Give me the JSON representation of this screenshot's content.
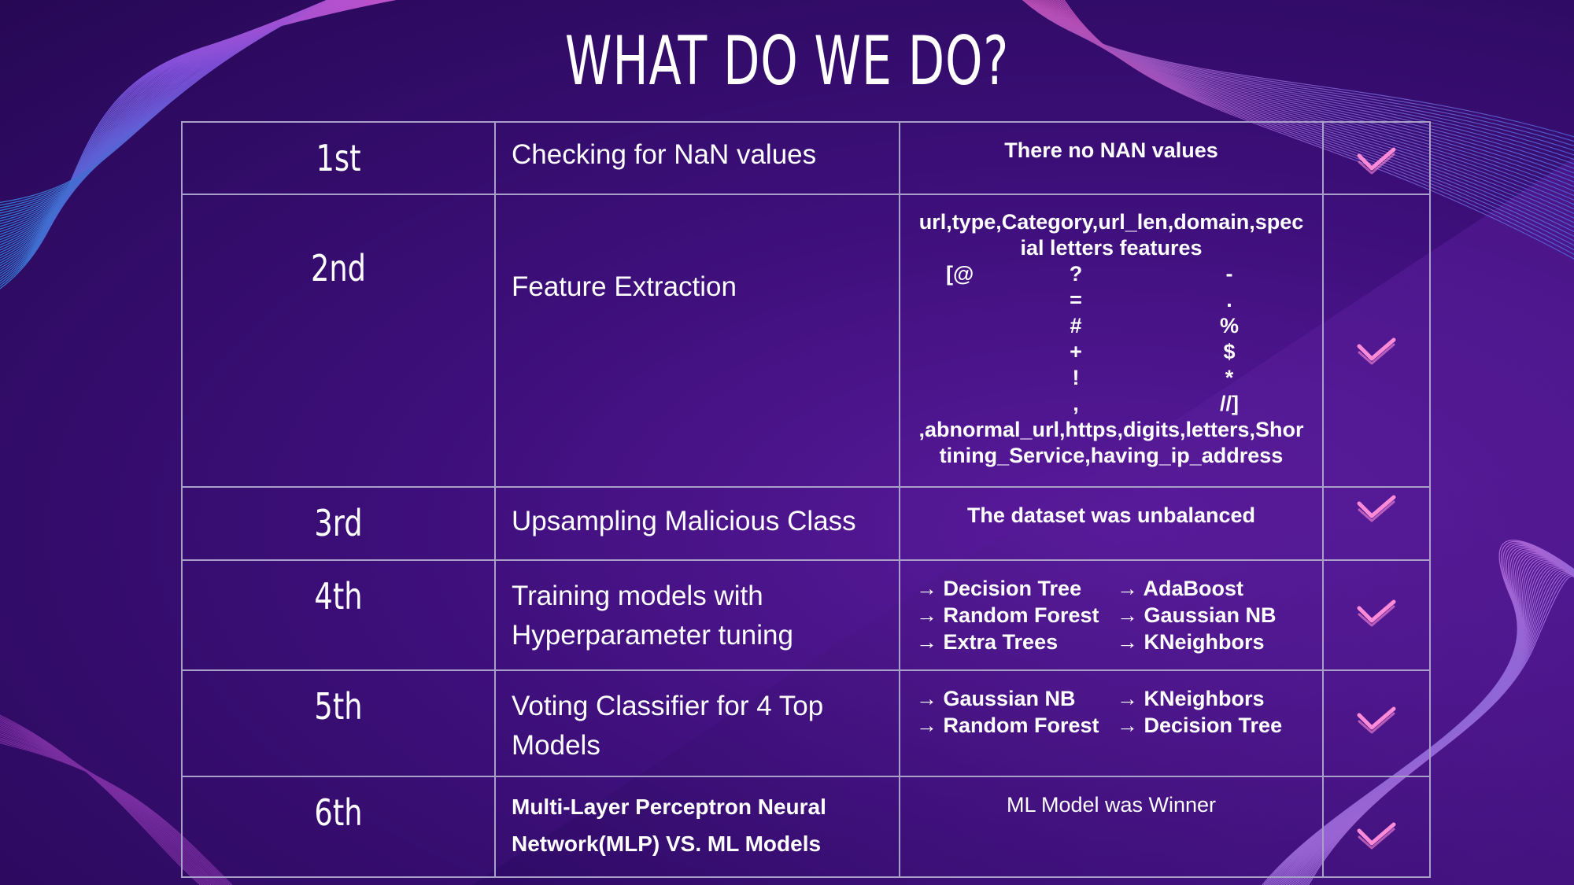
{
  "title": "WHAT DO WE DO?",
  "colors": {
    "check": "#ff8ad8",
    "border": "#a9a0c9",
    "bg": "#3d0f7a"
  },
  "rows": [
    {
      "num": "1st",
      "desc": "Checking for NaN values",
      "detail": "There no NAN values",
      "icon": "check-icon"
    },
    {
      "num": "2nd",
      "desc": "Feature Extraction",
      "detail_top": "url,type,Category,url_len,domain,special letters features",
      "symbols": [
        [
          "[@",
          "?",
          "-"
        ],
        [
          "",
          "=",
          "."
        ],
        [
          "",
          "#",
          "%"
        ],
        [
          "",
          "+",
          "$"
        ],
        [
          "",
          "!",
          "*"
        ],
        [
          "",
          ",",
          "//]"
        ]
      ],
      "detail_bottom": ",abnormal_url,https,digits,letters,Shortining_Service,having_ip_address",
      "icon": "check-icon"
    },
    {
      "num": "3rd",
      "desc": "Upsampling Malicious Class",
      "detail": "The dataset  was unbalanced",
      "icon": "check-icon"
    },
    {
      "num": "4th",
      "desc_line1": "Training models with",
      "desc_line2": "Hyperparameter tuning",
      "models": [
        "→ Decision Tree",
        "→  AdaBoost",
        "→ Random Forest",
        "→ Gaussian NB",
        "→  Extra Trees",
        "→ KNeighbors"
      ],
      "icon": "check-icon"
    },
    {
      "num": "5th",
      "desc_line1": "Voting Classifier for 4 Top",
      "desc_line2": "Models",
      "models": [
        "→ Gaussian NB",
        "→ KNeighbors",
        "→ Random Forest",
        "→ Decision Tree"
      ],
      "icon": "check-icon"
    },
    {
      "num": "6th",
      "desc_line1": "Multi-Layer Perceptron Neural",
      "desc_line2": "Network(MLP) VS. ML Models",
      "detail": "ML Model was Winner",
      "icon": "check-icon"
    }
  ]
}
